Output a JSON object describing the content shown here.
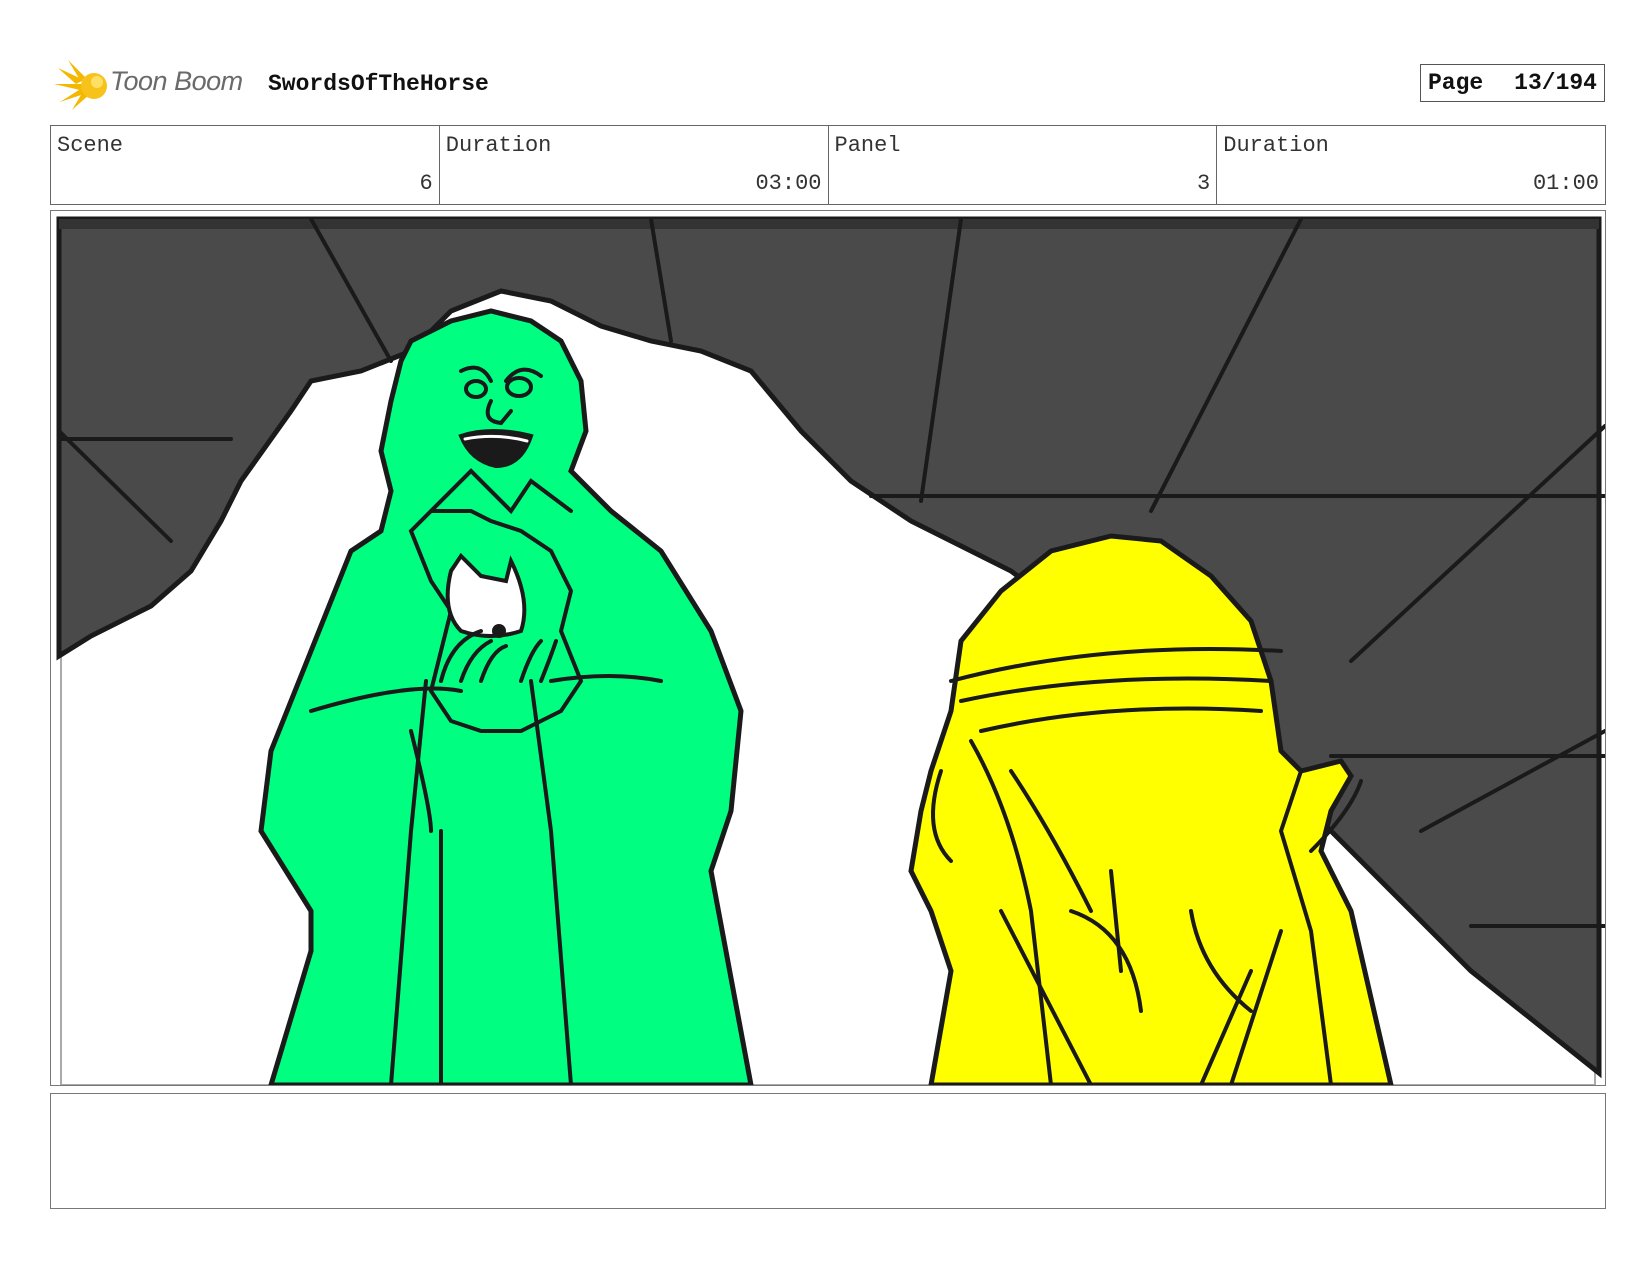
{
  "header": {
    "brand": "Toon Boom",
    "project_title": "SwordsOfTheHorse",
    "page_label": "Page",
    "page_value": "13/194"
  },
  "info": {
    "scene_label": "Scene",
    "scene_value": "6",
    "scene_duration_label": "Duration",
    "scene_duration_value": "03:00",
    "panel_label": "Panel",
    "panel_value": "3",
    "panel_duration_label": "Duration",
    "panel_duration_value": "01:00"
  },
  "panel": {
    "colors": {
      "rock": "#4a4a4a",
      "green_figure": "#00ff80",
      "yellow_figure": "#ffff00",
      "ink": "#1a1a1a"
    }
  },
  "notes": {
    "text": ""
  }
}
